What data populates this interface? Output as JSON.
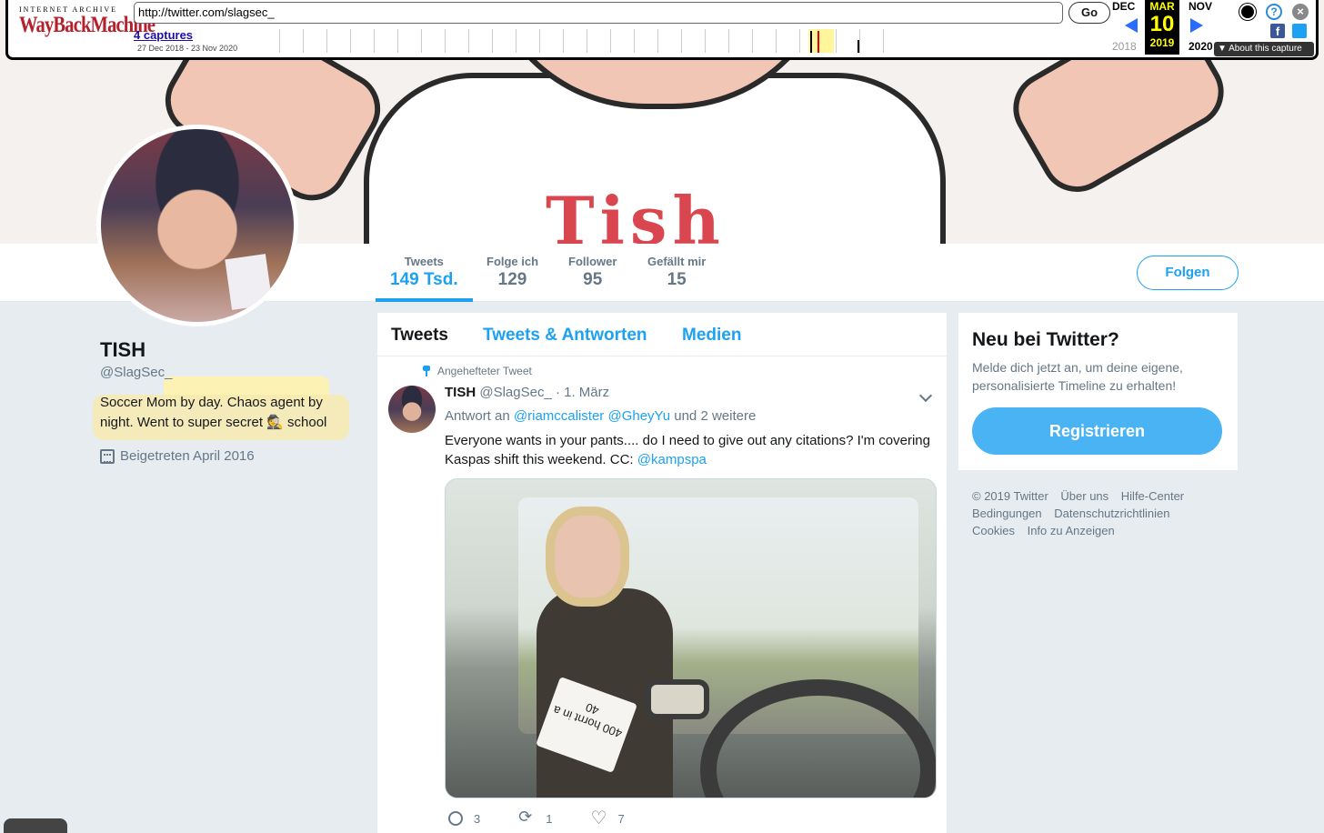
{
  "wayback": {
    "logo_top": "INTERNET ARCHIVE",
    "logo_main": "WayBackMachine",
    "url": "http://twitter.com/slagsec_",
    "go_label": "Go",
    "captures_label": "4 captures",
    "range": "27 Dec 2018 - 23 Nov 2020",
    "prev_month": "DEC",
    "cur_month": "MAR",
    "next_month": "NOV",
    "cur_day": "10",
    "prev_year": "2018",
    "cur_year": "2019",
    "next_year": "2020",
    "about_label": "▼ About this capture"
  },
  "profile": {
    "stats": [
      {
        "label": "Tweets",
        "value": "149 Tsd."
      },
      {
        "label": "Folge ich",
        "value": "129"
      },
      {
        "label": "Follower",
        "value": "95"
      },
      {
        "label": "Gefällt mir",
        "value": "15"
      }
    ],
    "follow_label": "Folgen",
    "name": "TISH",
    "handle": "@SlagSec_",
    "bio_line1": "Soccer Mom by day. Chaos agent by",
    "bio_line2_a": "night. Went to super secret",
    "bio_emoji": "🕵",
    "bio_line2_b": "school",
    "joined": "Beigetreten April 2016",
    "banner_text": "Tish"
  },
  "timeline": {
    "tabs": [
      "Tweets",
      "Tweets & Antworten",
      "Medien"
    ],
    "pinned_label": "Angehefteter Tweet",
    "tweet": {
      "name": "TISH",
      "handle": "@SlagSec_",
      "date": "· 1. März",
      "reply_prefix": "Antwort an",
      "reply_user1": "@riamccalister",
      "reply_user2": "@GheyYu",
      "reply_suffix": "und 2 weitere",
      "text": "Everyone wants in your pants.... do I need to give out any citations? I'm covering Kaspas shift this weekend. CC:",
      "text_mention": "@kampspa",
      "ticket_text": "400 hornt in a 40",
      "replies": "3",
      "retweets": "1",
      "likes": "7"
    }
  },
  "sidebar": {
    "title": "Neu bei Twitter?",
    "desc": "Melde dich jetzt an, um deine eigene, personalisierte Timeline zu erhalten!",
    "button": "Registrieren",
    "footer": [
      "© 2019 Twitter",
      "Über uns",
      "Hilfe-Center",
      "Bedingungen",
      "Datenschutzrichtlinien",
      "Cookies",
      "Info zu Anzeigen"
    ]
  },
  "colors": {
    "accent": "#1da1f2",
    "background": "#e6ecf0"
  }
}
